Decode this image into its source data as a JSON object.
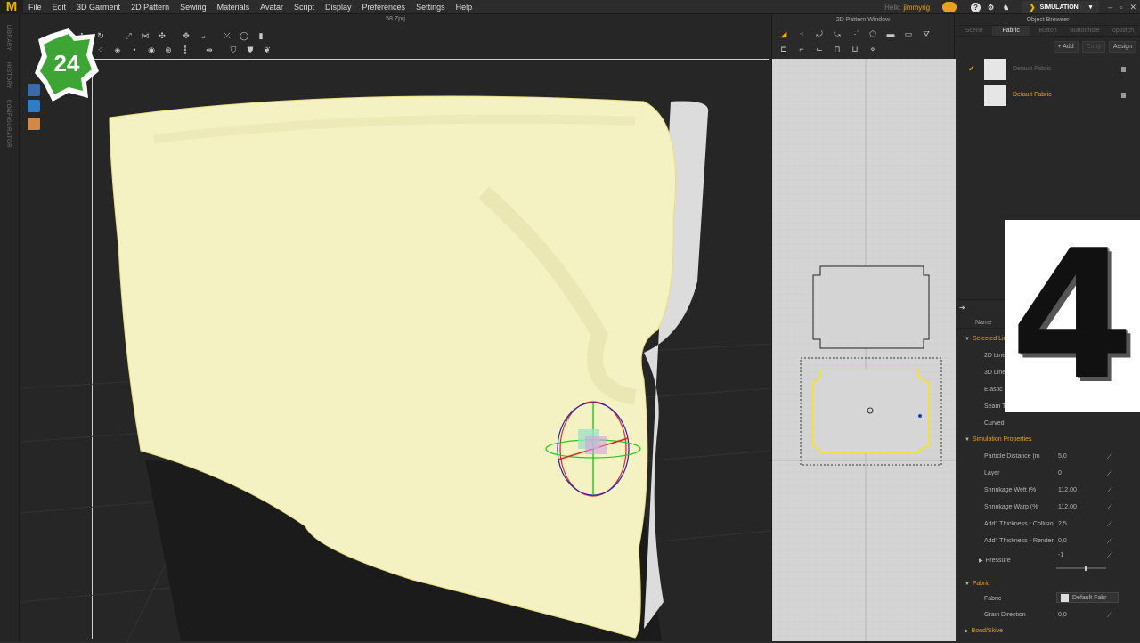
{
  "menubar": {
    "logo": "M",
    "items": [
      "File",
      "Edit",
      "3D Garment",
      "2D Pattern",
      "Sewing",
      "Materials",
      "Avatar",
      "Script",
      "Display",
      "Preferences",
      "Settings",
      "Help"
    ],
    "user_hello": "Hello",
    "user_name": "jimmyrig",
    "help_icon": "?",
    "mode_label": "SIMULATION",
    "window_controls": [
      "–",
      "▫",
      "✕"
    ]
  },
  "left_strip": {
    "tabs": [
      "LIBRARY",
      "HISTORY",
      "CONFIGURATOR"
    ]
  },
  "viewport": {
    "title": "58.Zprj",
    "badge": "24"
  },
  "pattern_window": {
    "title": "2D Pattern Window"
  },
  "object_browser": {
    "title": "Object Browser",
    "tabs": [
      "Scene",
      "Fabric",
      "Button",
      "Buttonhole",
      "Topstitch"
    ],
    "active_tab": "Fabric",
    "actions": {
      "add": "+ Add",
      "copy": "Copy",
      "assign": "Assign"
    },
    "fabrics": [
      {
        "name": "Default Fabric",
        "checked": true,
        "selected": false
      },
      {
        "name": "Default Fabric",
        "checked": false,
        "selected": true
      }
    ]
  },
  "property_editor": {
    "name_header": "Name",
    "selected_section": "Selected Line",
    "selected_props": [
      "2D Line",
      "3D Line",
      "Elastic",
      "Seam T",
      "Curved"
    ],
    "simulation_section": "Simulation Properties",
    "simulation_props": [
      {
        "label": "Particle Distance (m",
        "value": "5,0"
      },
      {
        "label": "Layer",
        "value": "0"
      },
      {
        "label": "Shrinkage Weft (%",
        "value": "112,00"
      },
      {
        "label": "Shrinkage Warp (%",
        "value": "112,00"
      },
      {
        "label": "Add'l Thickness - Collisio",
        "value": "2,5"
      },
      {
        "label": "Add'l Thickness - Renderi",
        "value": "0,0"
      }
    ],
    "pressure": {
      "label": "Pressure",
      "value": "-1"
    },
    "fabric_section": "Fabric",
    "fabric_props": [
      {
        "label": "Fabric",
        "value": "Default Fabr"
      },
      {
        "label": "Grain Direction",
        "value": "0,0"
      }
    ],
    "bond_section": "Bond/Skive"
  },
  "overlay_card": {
    "text": "4"
  },
  "colors": {
    "accent": "#e8a020",
    "pillow": "#f4f1c2",
    "background": "#262626"
  }
}
